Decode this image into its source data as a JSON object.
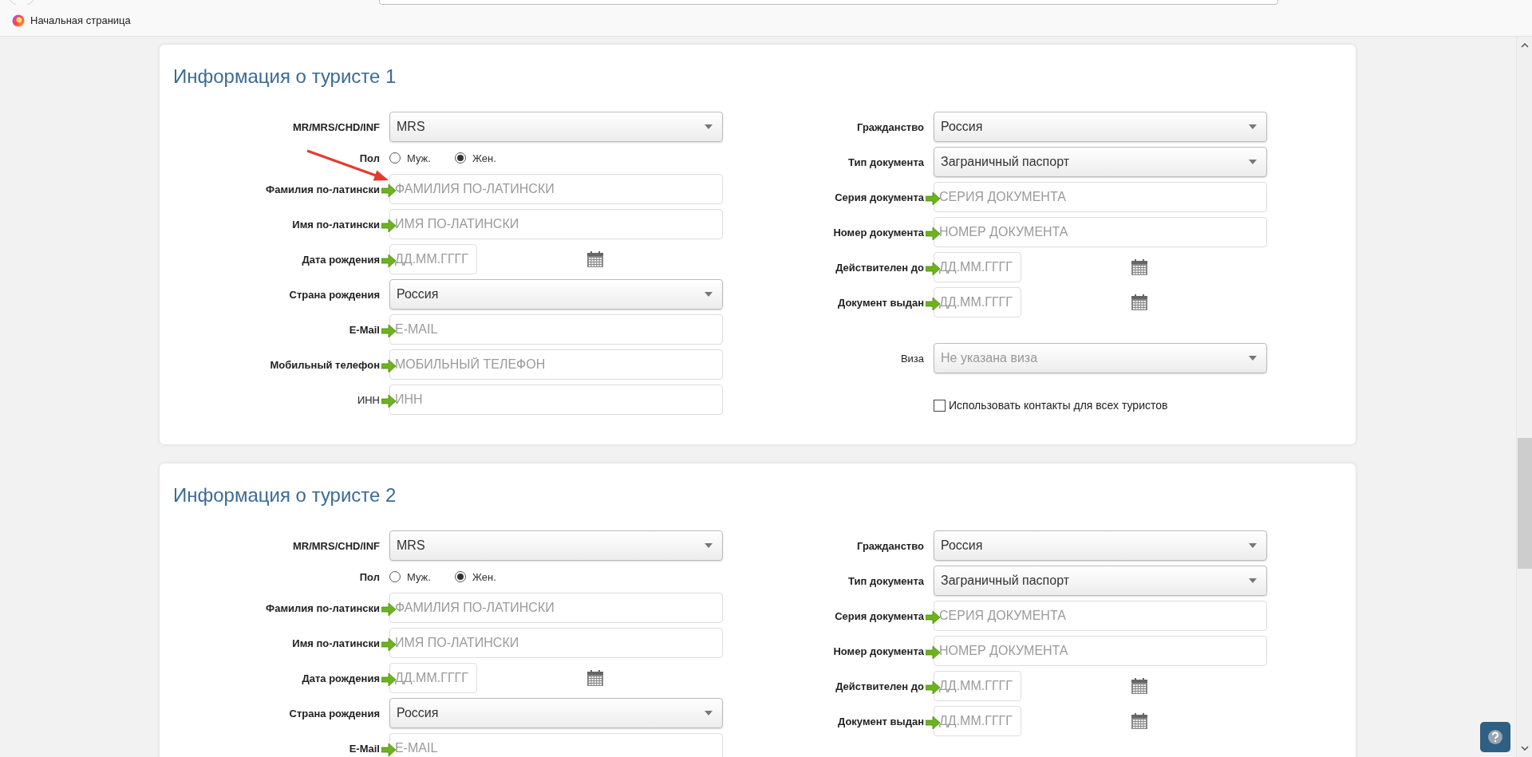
{
  "bookmarks_bar": {
    "items": [
      {
        "label": "Начальная страница"
      }
    ]
  },
  "tourists": [
    {
      "title": "Информация о туристе 1",
      "left_fields": [
        {
          "kind": "select",
          "label": "MR/MRS/CHD/INF",
          "bold_label": true,
          "value": "MRS"
        },
        {
          "kind": "radio",
          "label": "Пол",
          "bold_label": true,
          "options": [
            {
              "label": "Муж.",
              "selected": false
            },
            {
              "label": "Жен.",
              "selected": true
            }
          ]
        },
        {
          "kind": "text",
          "label": "Фамилия по-латински",
          "bold_label": true,
          "placeholder": "ФАМИЛИЯ ПО-ЛАТИНСКИ",
          "annotation_arrow": true
        },
        {
          "kind": "text",
          "label": "Имя по-латински",
          "bold_label": true,
          "placeholder": "ИМЯ ПО-ЛАТИНСКИ"
        },
        {
          "kind": "date",
          "label": "Дата рождения",
          "bold_label": true,
          "placeholder": "ДД.ММ.ГГГГ"
        },
        {
          "kind": "select",
          "label": "Страна рождения",
          "bold_label": true,
          "value": "Россия"
        },
        {
          "kind": "text",
          "label": "E-Mail",
          "bold_label": true,
          "placeholder": "E-MAIL"
        },
        {
          "kind": "text",
          "label": "Мобильный телефон",
          "bold_label": true,
          "placeholder": "МОБИЛЬНЫЙ ТЕЛЕФОН"
        },
        {
          "kind": "text",
          "label": "ИНН",
          "bold_label": false,
          "placeholder": "ИНН"
        }
      ],
      "right_fields": [
        {
          "kind": "select",
          "label": "Гражданство",
          "bold_label": true,
          "value": "Россия"
        },
        {
          "kind": "select",
          "label": "Тип документа",
          "bold_label": true,
          "value": "Заграничный паспорт"
        },
        {
          "kind": "text",
          "label": "Серия документа",
          "bold_label": true,
          "placeholder": "СЕРИЯ ДОКУМЕНТА"
        },
        {
          "kind": "text",
          "label": "Номер документа",
          "bold_label": true,
          "placeholder": "НОМЕР ДОКУМЕНТА"
        },
        {
          "kind": "date",
          "label": "Действителен до",
          "bold_label": true,
          "placeholder": "ДД.ММ.ГГГГ"
        },
        {
          "kind": "date",
          "label": "Документ выдан",
          "bold_label": true,
          "placeholder": "ДД.ММ.ГГГГ"
        }
      ],
      "right_extra_fields": [
        {
          "kind": "select",
          "label": "Виза",
          "bold_label": false,
          "placeholder": "Не указана виза"
        },
        {
          "kind": "checkbox",
          "label": "Использовать контакты для всех туристов",
          "checked": false
        }
      ]
    },
    {
      "title": "Информация о туристе 2",
      "left_fields": [
        {
          "kind": "select",
          "label": "MR/MRS/CHD/INF",
          "bold_label": true,
          "value": "MRS"
        },
        {
          "kind": "radio",
          "label": "Пол",
          "bold_label": true,
          "options": [
            {
              "label": "Муж.",
              "selected": false
            },
            {
              "label": "Жен.",
              "selected": true
            }
          ]
        },
        {
          "kind": "text",
          "label": "Фамилия по-латински",
          "bold_label": true,
          "placeholder": "ФАМИЛИЯ ПО-ЛАТИНСКИ"
        },
        {
          "kind": "text",
          "label": "Имя по-латински",
          "bold_label": true,
          "placeholder": "ИМЯ ПО-ЛАТИНСКИ"
        },
        {
          "kind": "date",
          "label": "Дата рождения",
          "bold_label": true,
          "placeholder": "ДД.ММ.ГГГГ"
        },
        {
          "kind": "select",
          "label": "Страна рождения",
          "bold_label": true,
          "value": "Россия"
        },
        {
          "kind": "text",
          "label": "E-Mail",
          "bold_label": true,
          "placeholder": "E-MAIL"
        }
      ],
      "right_fields": [
        {
          "kind": "select",
          "label": "Гражданство",
          "bold_label": true,
          "value": "Россия"
        },
        {
          "kind": "select",
          "label": "Тип документа",
          "bold_label": true,
          "value": "Заграничный паспорт"
        },
        {
          "kind": "text",
          "label": "Серия документа",
          "bold_label": true,
          "placeholder": "СЕРИЯ ДОКУМЕНТА"
        },
        {
          "kind": "text",
          "label": "Номер документа",
          "bold_label": true,
          "placeholder": "НОМЕР ДОКУМЕНТА"
        },
        {
          "kind": "date",
          "label": "Действителен до",
          "bold_label": true,
          "placeholder": "ДД.ММ.ГГГГ"
        },
        {
          "kind": "date",
          "label": "Документ выдан",
          "bold_label": true,
          "placeholder": "ДД.ММ.ГГГГ"
        }
      ]
    }
  ]
}
